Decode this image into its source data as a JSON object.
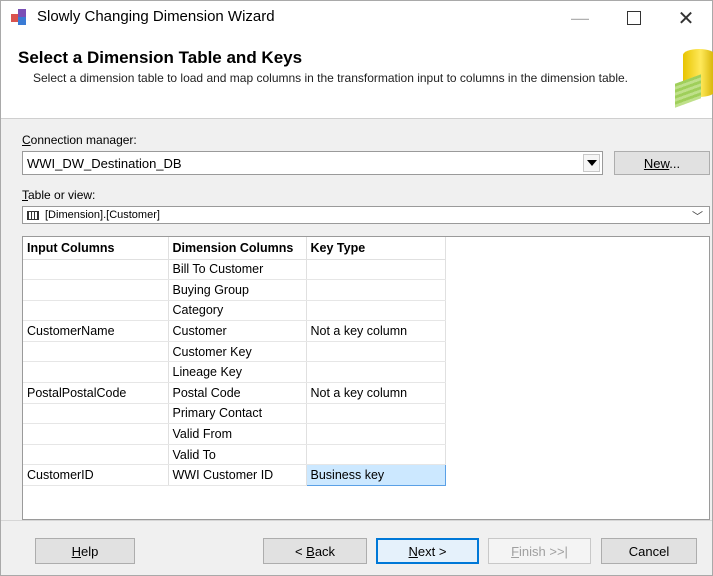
{
  "window": {
    "title": "Slowly Changing Dimension Wizard"
  },
  "header": {
    "title": "Select a Dimension Table and Keys",
    "description": "Select a dimension table to load and map columns in the transformation input to columns in the dimension table."
  },
  "connection_manager": {
    "label_underlined": "C",
    "label_rest": "onnection manager:",
    "value": "WWI_DW_Destination_DB",
    "new_button_underlined": "New",
    "new_button_rest": "..."
  },
  "table_or_view": {
    "label_underlined": "T",
    "label_rest": "able or view:",
    "value": "[Dimension].[Customer]"
  },
  "mapping": {
    "headers": [
      "Input Columns",
      "Dimension Columns",
      "Key Type"
    ],
    "rows": [
      [
        "",
        "Bill To Customer",
        ""
      ],
      [
        "",
        "Buying Group",
        ""
      ],
      [
        "",
        "Category",
        ""
      ],
      [
        "CustomerName",
        "Customer",
        "Not a key column"
      ],
      [
        "",
        "Customer Key",
        ""
      ],
      [
        "",
        "Lineage Key",
        ""
      ],
      [
        "PostalPostalCode",
        "Postal Code",
        "Not a key column"
      ],
      [
        "",
        "Primary Contact",
        ""
      ],
      [
        "",
        "Valid From",
        ""
      ],
      [
        "",
        "Valid To",
        ""
      ],
      [
        "CustomerID",
        "WWI Customer ID",
        "Business key"
      ]
    ]
  },
  "buttons": {
    "help_u": "H",
    "help_rest": "elp",
    "back_pre": "< ",
    "back_u": "B",
    "back_rest": "ack",
    "next_u": "N",
    "next_rest": "ext >",
    "finish_u": "F",
    "finish_rest": "inish >>|",
    "cancel": "Cancel"
  },
  "colors": {
    "selection": "#cce8ff",
    "accent": "#0078d7"
  }
}
